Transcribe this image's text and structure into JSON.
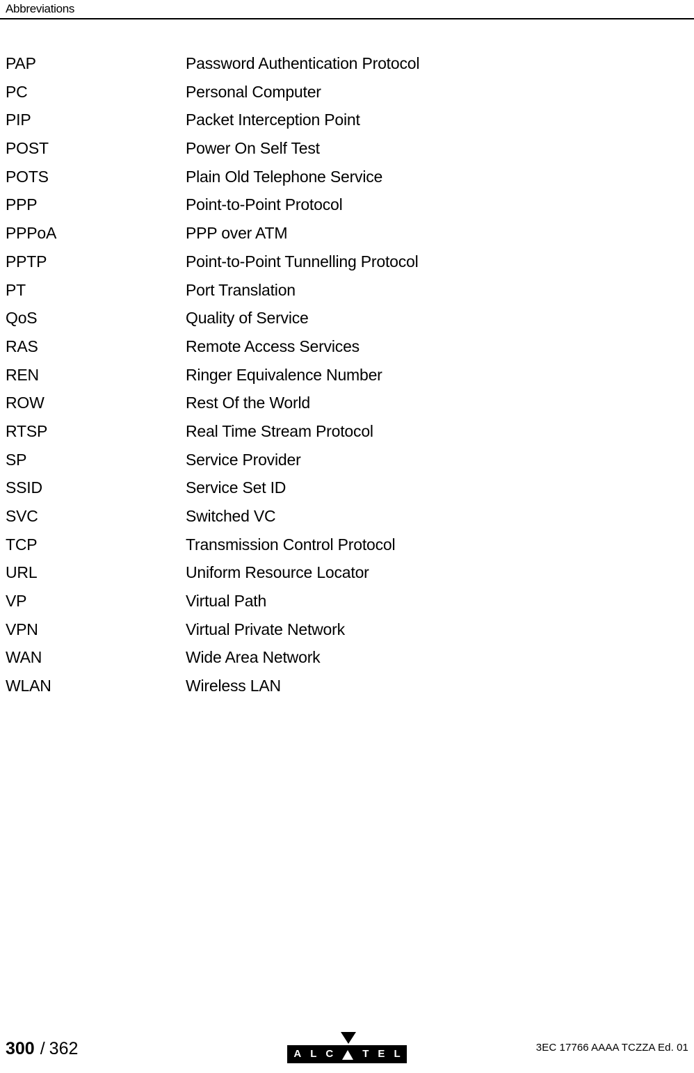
{
  "header": {
    "title": "Abbreviations"
  },
  "glossary": {
    "rows": [
      {
        "term": "PAP",
        "definition": "Password Authentication Protocol"
      },
      {
        "term": "PC",
        "definition": "Personal Computer"
      },
      {
        "term": "PIP",
        "definition": "Packet Interception Point"
      },
      {
        "term": "POST",
        "definition": "Power On Self Test"
      },
      {
        "term": "POTS",
        "definition": "Plain Old Telephone Service"
      },
      {
        "term": "PPP",
        "definition": "Point-to-Point Protocol"
      },
      {
        "term": "PPPoA",
        "definition": "PPP over ATM"
      },
      {
        "term": "PPTP",
        "definition": "Point-to-Point Tunnelling Protocol"
      },
      {
        "term": "PT",
        "definition": "Port Translation"
      },
      {
        "term": "QoS",
        "definition": "Quality of Service"
      },
      {
        "term": "RAS",
        "definition": "Remote Access Services"
      },
      {
        "term": "REN",
        "definition": "Ringer Equivalence Number"
      },
      {
        "term": "ROW",
        "definition": "Rest Of the World"
      },
      {
        "term": "RTSP",
        "definition": "Real Time Stream Protocol"
      },
      {
        "term": "SP",
        "definition": "Service Provider"
      },
      {
        "term": "SSID",
        "definition": "Service Set ID"
      },
      {
        "term": "SVC",
        "definition": "Switched VC"
      },
      {
        "term": "TCP",
        "definition": "Transmission Control Protocol"
      },
      {
        "term": "URL",
        "definition": "Uniform Resource Locator"
      },
      {
        "term": "VP",
        "definition": "Virtual Path"
      },
      {
        "term": "VPN",
        "definition": "Virtual Private Network"
      },
      {
        "term": "WAN",
        "definition": "Wide Area Network"
      },
      {
        "term": "WLAN",
        "definition": "Wireless LAN"
      }
    ]
  },
  "footer": {
    "page_current": "300",
    "page_separator": "/",
    "page_total": "362",
    "logo": {
      "name": "alcatel-logo",
      "letters": [
        "A",
        "L",
        "C",
        "A",
        "T",
        "E",
        "L"
      ],
      "triangle_letter_index": 3,
      "bar_color": "#000000",
      "letter_color": "#ffffff"
    },
    "document_reference": "3EC 17766 AAAA TCZZA Ed. 01"
  }
}
